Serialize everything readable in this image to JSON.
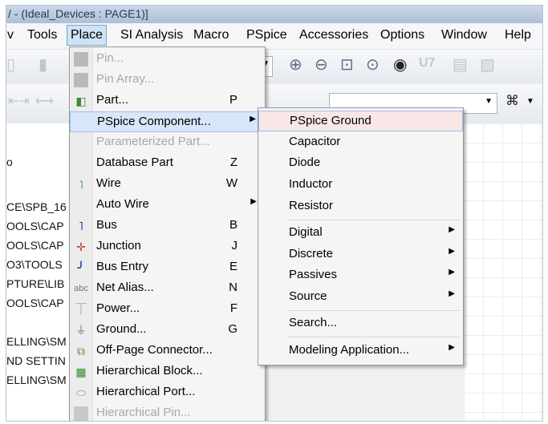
{
  "window": {
    "title": "/ - (Ideal_Devices : PAGE1)]"
  },
  "menubar": {
    "items": [
      {
        "label": "v"
      },
      {
        "label": "Tools"
      },
      {
        "label": "Place"
      },
      {
        "label": "SI Analysis"
      },
      {
        "label": "Macro"
      },
      {
        "label": "PSpice"
      },
      {
        "label": "Accessories"
      },
      {
        "label": "Options"
      },
      {
        "label": "Window"
      },
      {
        "label": "Help"
      }
    ]
  },
  "toolbar": {
    "icons": [
      "zoom-in-icon",
      "zoom-out-icon",
      "zoom-area-icon",
      "zoom-all-icon",
      "eye-icon",
      "u7-icon",
      "annotate-icon",
      "export-icon"
    ],
    "search_icon": "binoculars-icon"
  },
  "sidepanel": {
    "rows": [
      "o",
      "CE\\SPB_16",
      "OOLS\\CAP",
      "OOLS\\CAP",
      "O3\\TOOLS",
      "PTURE\\LIB",
      "OOLS\\CAP",
      "ELLING\\SM",
      "ND SETTIN",
      "ELLING\\SM"
    ]
  },
  "place_menu": {
    "items": [
      {
        "label": "Pin...",
        "key": "",
        "disabled": true
      },
      {
        "label": "Pin Array...",
        "key": "",
        "disabled": true
      },
      {
        "label": "Part...",
        "key": "P",
        "disabled": false
      },
      {
        "label": "PSpice Component...",
        "key": "",
        "disabled": false,
        "submenu": true
      },
      {
        "label": "Parameterized Part...",
        "key": "",
        "disabled": true
      },
      {
        "label": "Database Part",
        "key": "Z",
        "disabled": false
      },
      {
        "label": "Wire",
        "key": "W",
        "disabled": false
      },
      {
        "label": "Auto Wire",
        "key": "",
        "disabled": false,
        "submenu": true
      },
      {
        "label": "Bus",
        "key": "B",
        "disabled": false
      },
      {
        "label": "Junction",
        "key": "J",
        "disabled": false
      },
      {
        "label": "Bus Entry",
        "key": "E",
        "disabled": false
      },
      {
        "label": "Net Alias...",
        "key": "N",
        "disabled": false
      },
      {
        "label": "Power...",
        "key": "F",
        "disabled": false
      },
      {
        "label": "Ground...",
        "key": "G",
        "disabled": false
      },
      {
        "label": "Off-Page Connector...",
        "key": "",
        "disabled": false
      },
      {
        "label": "Hierarchical Block...",
        "key": "",
        "disabled": false
      },
      {
        "label": "Hierarchical Port...",
        "key": "",
        "disabled": false
      },
      {
        "label": "Hierarchical Pin...",
        "key": "",
        "disabled": true
      }
    ]
  },
  "pspice_submenu": {
    "items": [
      {
        "label": "PSpice Ground",
        "submenu": false
      },
      {
        "label": "Capacitor",
        "submenu": false
      },
      {
        "label": "Diode",
        "submenu": false
      },
      {
        "label": "Inductor",
        "submenu": false
      },
      {
        "label": "Resistor",
        "submenu": false
      },
      {
        "label": "Digital",
        "submenu": true
      },
      {
        "label": "Discrete",
        "submenu": true
      },
      {
        "label": "Passives",
        "submenu": true
      },
      {
        "label": "Source",
        "submenu": true
      },
      {
        "label": "Search...",
        "submenu": false
      },
      {
        "label": "Modeling Application...",
        "submenu": true
      }
    ]
  },
  "colors": {
    "menu_highlight": "#d7e6f8",
    "submenu_highlight": "#f9e7e7",
    "active_menu": "#cfe2f7"
  }
}
